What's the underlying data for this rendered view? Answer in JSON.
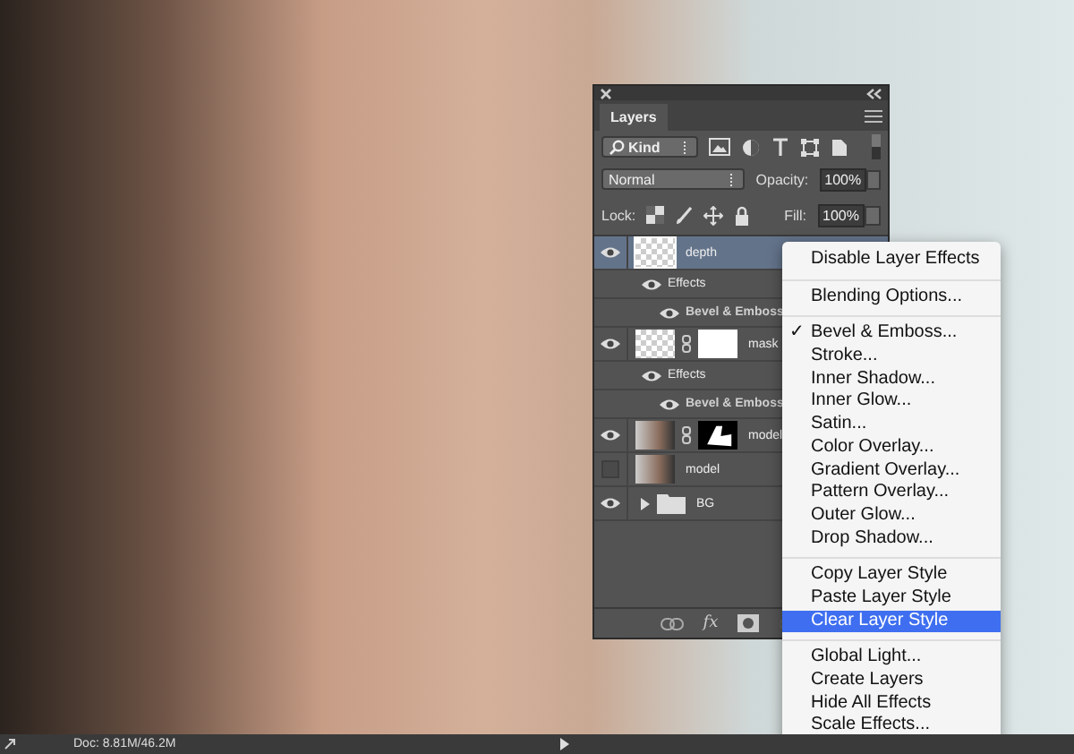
{
  "panel": {
    "tab": "Layers",
    "filter": {
      "value": "Kind"
    },
    "blend_mode": {
      "value": "Normal"
    },
    "opacity": {
      "label": "Opacity:",
      "value": "100%"
    },
    "lock": {
      "label": "Lock:"
    },
    "fill": {
      "label": "Fill:",
      "value": "100%"
    },
    "layers": [
      {
        "name": "depth",
        "kind": "layer",
        "visible": true,
        "selected": true,
        "thumbnail": {
          "kind": "transparent"
        },
        "children": [
          {
            "name": "Effects",
            "kind": "effects",
            "visible": true,
            "children": [
              {
                "name": "Bevel & Emboss",
                "kind": "effect",
                "visible": true
              }
            ]
          }
        ]
      },
      {
        "name": "mask",
        "kind": "layer",
        "visible": true,
        "selected": false,
        "thumbnail": {
          "kind": "transparent"
        },
        "mask": {
          "kind": "white"
        },
        "children": [
          {
            "name": "Effects",
            "kind": "effects",
            "visible": true,
            "children": [
              {
                "name": "Bevel & Emboss",
                "kind": "effect",
                "visible": true
              }
            ]
          }
        ]
      },
      {
        "name": "model",
        "kind": "layer",
        "visible": true,
        "selected": false,
        "thumbnail": {
          "kind": "photo"
        },
        "mask": {
          "kind": "shape"
        }
      },
      {
        "name": "model",
        "kind": "layer",
        "visible": false,
        "selected": false,
        "thumbnail": {
          "kind": "photo"
        }
      },
      {
        "name": "BG",
        "kind": "group",
        "visible": true,
        "selected": false,
        "expanded": false
      }
    ],
    "fx_label": "fx"
  },
  "menu": {
    "groups": [
      [
        {
          "label": "Disable Layer Effects",
          "checked": false,
          "selected": false
        }
      ],
      [
        {
          "label": "Blending Options...",
          "checked": false,
          "selected": false
        }
      ],
      [
        {
          "label": "Bevel & Emboss...",
          "checked": true,
          "selected": false
        },
        {
          "label": "Stroke...",
          "checked": false,
          "selected": false
        },
        {
          "label": "Inner Shadow...",
          "checked": false,
          "selected": false
        },
        {
          "label": "Inner Glow...",
          "checked": false,
          "selected": false
        },
        {
          "label": "Satin...",
          "checked": false,
          "selected": false
        },
        {
          "label": "Color Overlay...",
          "checked": false,
          "selected": false
        },
        {
          "label": "Gradient Overlay...",
          "checked": false,
          "selected": false
        },
        {
          "label": "Pattern Overlay...",
          "checked": false,
          "selected": false
        },
        {
          "label": "Outer Glow...",
          "checked": false,
          "selected": false
        },
        {
          "label": "Drop Shadow...",
          "checked": false,
          "selected": false
        }
      ],
      [
        {
          "label": "Copy Layer Style",
          "checked": false,
          "selected": false
        },
        {
          "label": "Paste Layer Style",
          "checked": false,
          "selected": false
        },
        {
          "label": "Clear Layer Style",
          "checked": false,
          "selected": true
        }
      ],
      [
        {
          "label": "Global Light...",
          "checked": false,
          "selected": false
        },
        {
          "label": "Create Layers",
          "checked": false,
          "selected": false
        },
        {
          "label": "Hide All Effects",
          "checked": false,
          "selected": false
        },
        {
          "label": "Scale Effects...",
          "checked": false,
          "selected": false
        }
      ]
    ],
    "check_mark": "✓"
  },
  "status_bar": {
    "doc": "Doc: 8.81M/46.2M"
  }
}
